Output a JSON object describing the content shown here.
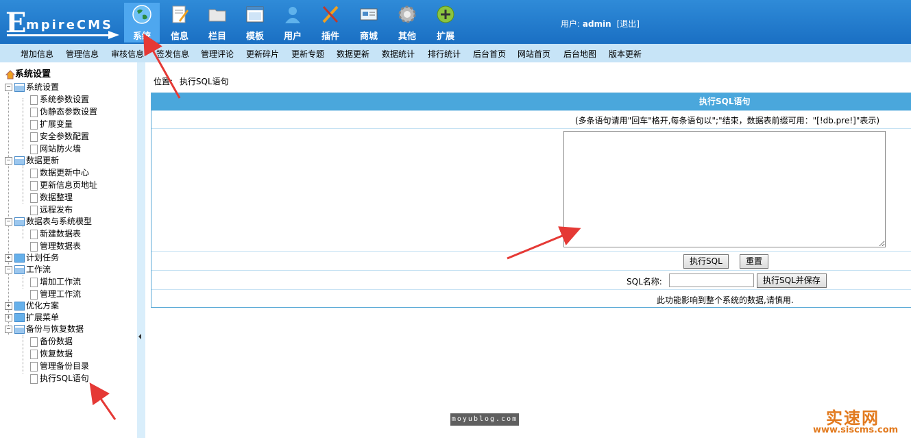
{
  "logo": {
    "first": "E",
    "rest": "mpireCMS"
  },
  "nav": [
    {
      "label": "系统",
      "icon": "globe-icon"
    },
    {
      "label": "信息",
      "icon": "document-pencil-icon"
    },
    {
      "label": "栏目",
      "icon": "folder-icon"
    },
    {
      "label": "模板",
      "icon": "window-template-icon"
    },
    {
      "label": "用户",
      "icon": "user-icon"
    },
    {
      "label": "插件",
      "icon": "tools-icon"
    },
    {
      "label": "商城",
      "icon": "shop-card-icon"
    },
    {
      "label": "其他",
      "icon": "gear-icon"
    },
    {
      "label": "扩展",
      "icon": "plus-circle-icon"
    }
  ],
  "user": {
    "prefix": "用户:",
    "name": "admin",
    "logout": "[退出]"
  },
  "submenu": [
    "增加信息",
    "管理信息",
    "审核信息",
    "签发信息",
    "管理评论",
    "更新碎片",
    "更新专题",
    "数据更新",
    "数据统计",
    "排行统计",
    "后台首页",
    "网站首页",
    "后台地图",
    "版本更新"
  ],
  "tree": {
    "root": "系统设置",
    "g1": "系统设置",
    "g1_items": [
      "系统参数设置",
      "伪静态参数设置",
      "扩展变量",
      "安全参数配置",
      "网站防火墙"
    ],
    "g2": "数据更新",
    "g2_items": [
      "数据更新中心",
      "更新信息页地址",
      "数据整理",
      "远程发布"
    ],
    "g3": "数据表与系统模型",
    "g3_items": [
      "新建数据表",
      "管理数据表"
    ],
    "g4": "计划任务",
    "g5": "工作流",
    "g5_items": [
      "增加工作流",
      "管理工作流"
    ],
    "g6": "优化方案",
    "g7": "扩展菜单",
    "g8": "备份与恢复数据",
    "g8_items": [
      "备份数据",
      "恢复数据",
      "管理备份目录",
      "执行SQL语句"
    ]
  },
  "location": {
    "label": "位置:",
    "current": "执行SQL语句"
  },
  "panel": {
    "title": "执行SQL语句",
    "hint": "(多条语句请用\"回车\"格开,每条语句以\";\"结束，数据表前缀可用：\"[!db.pre!]\"表示)",
    "exec_button": "执行SQL",
    "reset_button": "重置",
    "sql_name_label": "SQL名称:",
    "exec_save_button": "执行SQL并保存",
    "warning": "此功能影响到整个系统的数据,请慎用."
  },
  "watermarks": {
    "blog": "moyublog.com",
    "brand": "实速网",
    "url": "www.siscms.com"
  },
  "colors": {
    "header": "#1a6fc3",
    "submenu": "#c7e4f7",
    "panel_title": "#4aa7dc",
    "annotation_arrow": "#e53935"
  }
}
